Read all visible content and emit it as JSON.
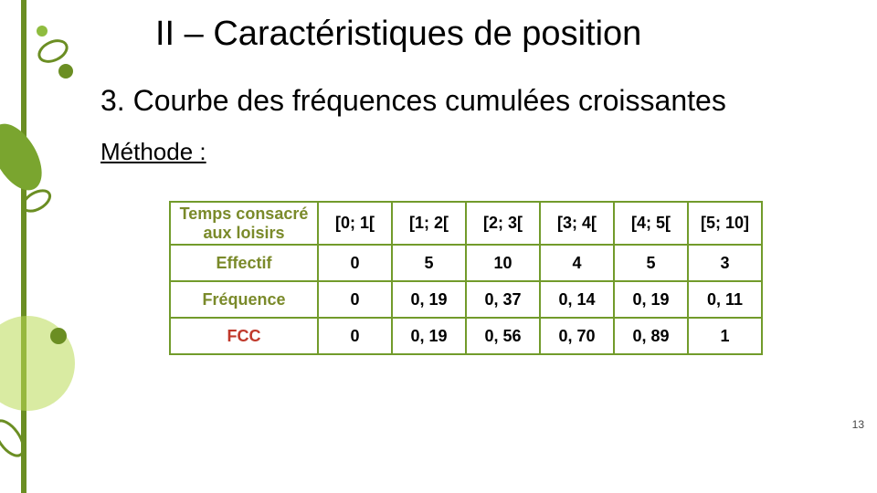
{
  "title": "II – Caractéristiques de position",
  "subtitle": "3. Courbe des fréquences cumulées croissantes",
  "methodLabel": "Méthode :",
  "table": {
    "headerRowLabel": "Temps consacré aux loisirs",
    "intervals": [
      "[0; 1[",
      "[1; 2[",
      "[2; 3[",
      "[3; 4[",
      "[4; 5[",
      "[5; 10]"
    ],
    "rows": [
      {
        "label": "Effectif",
        "labelClass": "row-head",
        "values": [
          "0",
          "5",
          "10",
          "4",
          "5",
          "3"
        ]
      },
      {
        "label": "Fréquence",
        "labelClass": "row-head",
        "values": [
          "0",
          "0, 19",
          "0, 37",
          "0, 14",
          "0, 19",
          "0, 11"
        ]
      },
      {
        "label": "FCC",
        "labelClass": "row-head",
        "rowClass": "fcc",
        "values": [
          "0",
          "0, 19",
          "0, 56",
          "0, 70",
          "0, 89",
          "1"
        ]
      }
    ]
  },
  "pageNumber": "13",
  "chart_data": {
    "type": "table",
    "title": "Temps consacré aux loisirs",
    "categories": [
      "[0; 1[",
      "[1; 2[",
      "[2; 3[",
      "[3; 4[",
      "[4; 5[",
      "[5; 10]"
    ],
    "series": [
      {
        "name": "Effectif",
        "values": [
          0,
          5,
          10,
          4,
          5,
          3
        ]
      },
      {
        "name": "Fréquence",
        "values": [
          0,
          0.19,
          0.37,
          0.14,
          0.19,
          0.11
        ]
      },
      {
        "name": "FCC",
        "values": [
          0,
          0.19,
          0.56,
          0.7,
          0.89,
          1
        ]
      }
    ]
  }
}
